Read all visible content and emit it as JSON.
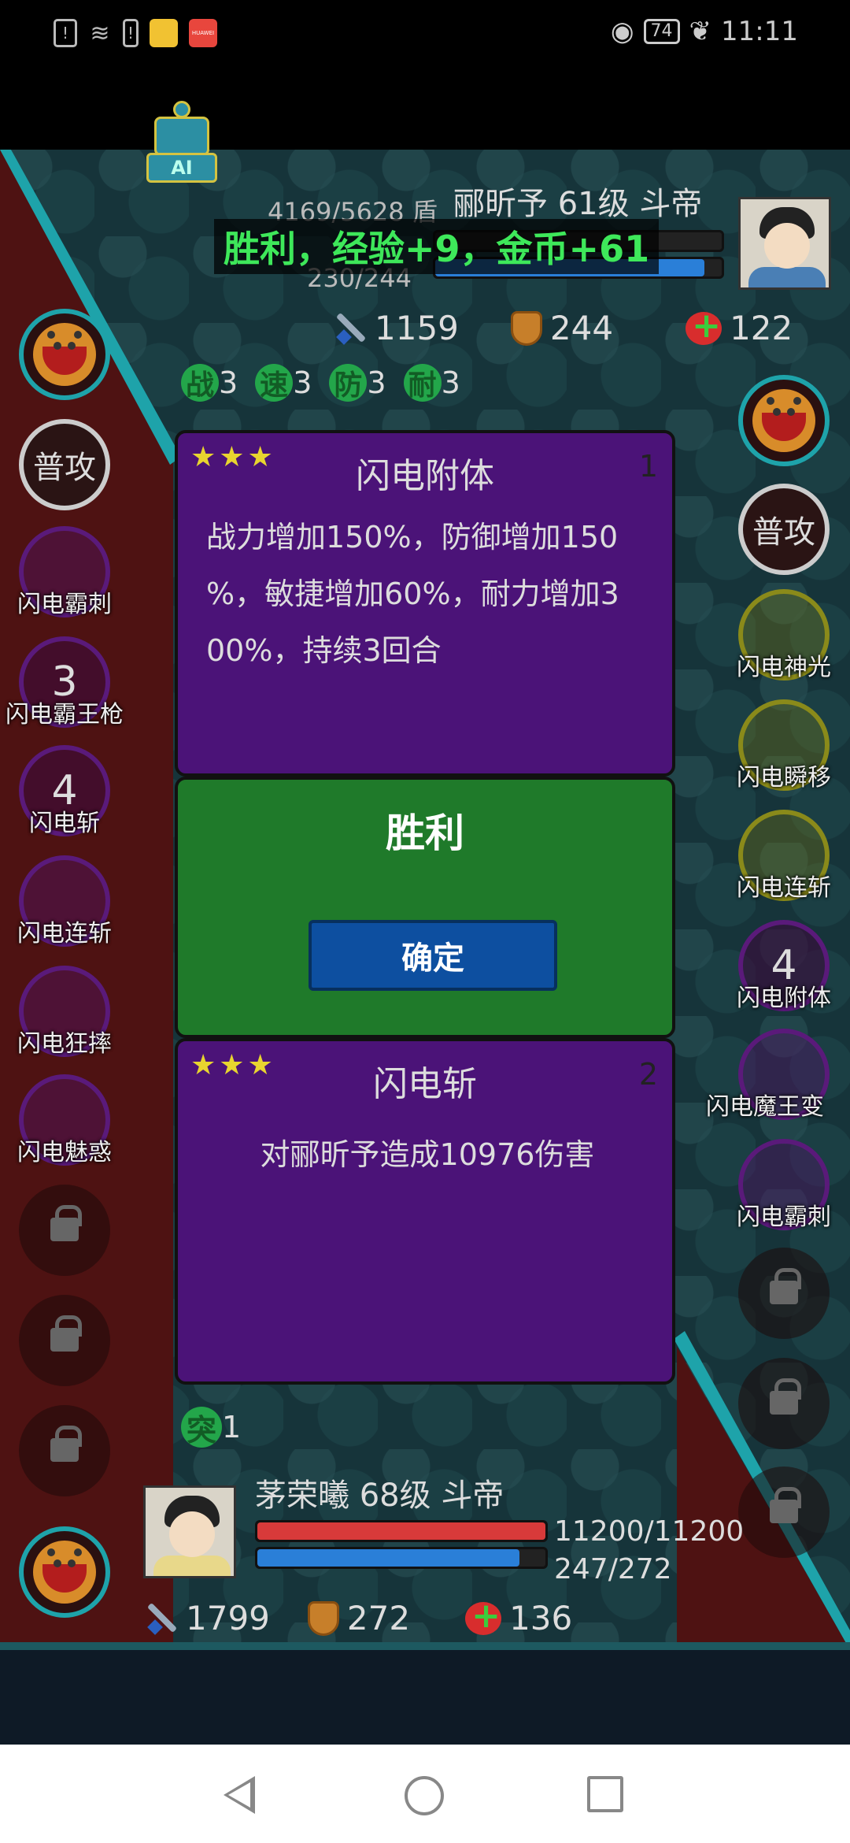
{
  "status_bar": {
    "time": "11:11",
    "battery": "74",
    "icons": [
      "alert-icon",
      "wifi-icon",
      "battery-saver-icon",
      "app-icon",
      "huawei-icon",
      "eye-icon",
      "leaf-icon"
    ],
    "huawei_label": "HUAWEI"
  },
  "robot": {
    "label": "AI"
  },
  "enemy": {
    "name": "郦昕予 61级 斗帝",
    "shield": "4169/5628 盾",
    "mp": "230/244",
    "attack": "1159",
    "defense": "244",
    "heal": "122",
    "hp_fraction": 0.0,
    "mp_fraction": 0.94
  },
  "victory_banner": "胜利，经验+9，金币+61",
  "buffs": [
    {
      "icon": "战",
      "count": "3"
    },
    {
      "icon": "速",
      "count": "3"
    },
    {
      "icon": "防",
      "count": "3"
    },
    {
      "icon": "耐",
      "count": "3"
    }
  ],
  "left_skills": [
    {
      "label": "",
      "glyph": ""
    },
    {
      "label": "",
      "glyph": "普攻"
    },
    {
      "label": "闪电霸刺",
      "glyph": ""
    },
    {
      "label": "闪电霸王枪",
      "glyph": "3"
    },
    {
      "label": "闪电斩",
      "glyph": "4"
    },
    {
      "label": "闪电连斩",
      "glyph": ""
    },
    {
      "label": "闪电狂摔",
      "glyph": ""
    },
    {
      "label": "闪电魅惑",
      "glyph": ""
    }
  ],
  "right_skills": [
    {
      "label": "",
      "glyph": ""
    },
    {
      "label": "",
      "glyph": "普攻"
    },
    {
      "label": "闪电神光",
      "glyph": ""
    },
    {
      "label": "闪电瞬移",
      "glyph": ""
    },
    {
      "label": "闪电连斩",
      "glyph": ""
    },
    {
      "label": "闪电附体",
      "glyph": "4"
    },
    {
      "label": "闪电魔王变",
      "glyph": ""
    },
    {
      "label": "闪电霸刺",
      "glyph": ""
    }
  ],
  "card1": {
    "stars": "★★★",
    "title": "闪电附体",
    "number": "1",
    "body_lines": [
      "战力增加150%，防御增加150",
      "%，敏捷增加60%，耐力增加3",
      "00%，持续3回合"
    ]
  },
  "win_dialog": {
    "title": "胜利",
    "confirm": "确定"
  },
  "card2": {
    "stars": "★★★",
    "title": "闪电斩",
    "number": "2",
    "body": "对郦昕予造成10976伤害"
  },
  "tu_buff": {
    "icon": "突",
    "count": "1"
  },
  "player": {
    "name": "茅荣曦 68级 斗帝",
    "hp": "11200/11200",
    "mp": "247/272",
    "attack": "1799",
    "defense": "272",
    "heal": "136",
    "hp_fraction": 1.0,
    "mp_fraction": 0.91
  },
  "colors": {
    "victory_green": "#3ee85a",
    "card_purple": "#4b1378",
    "card_green": "#1f7a2a",
    "confirm_blue": "#0d4fa0",
    "hp_red": "#d83a3a",
    "mp_blue": "#2a7fd8"
  }
}
